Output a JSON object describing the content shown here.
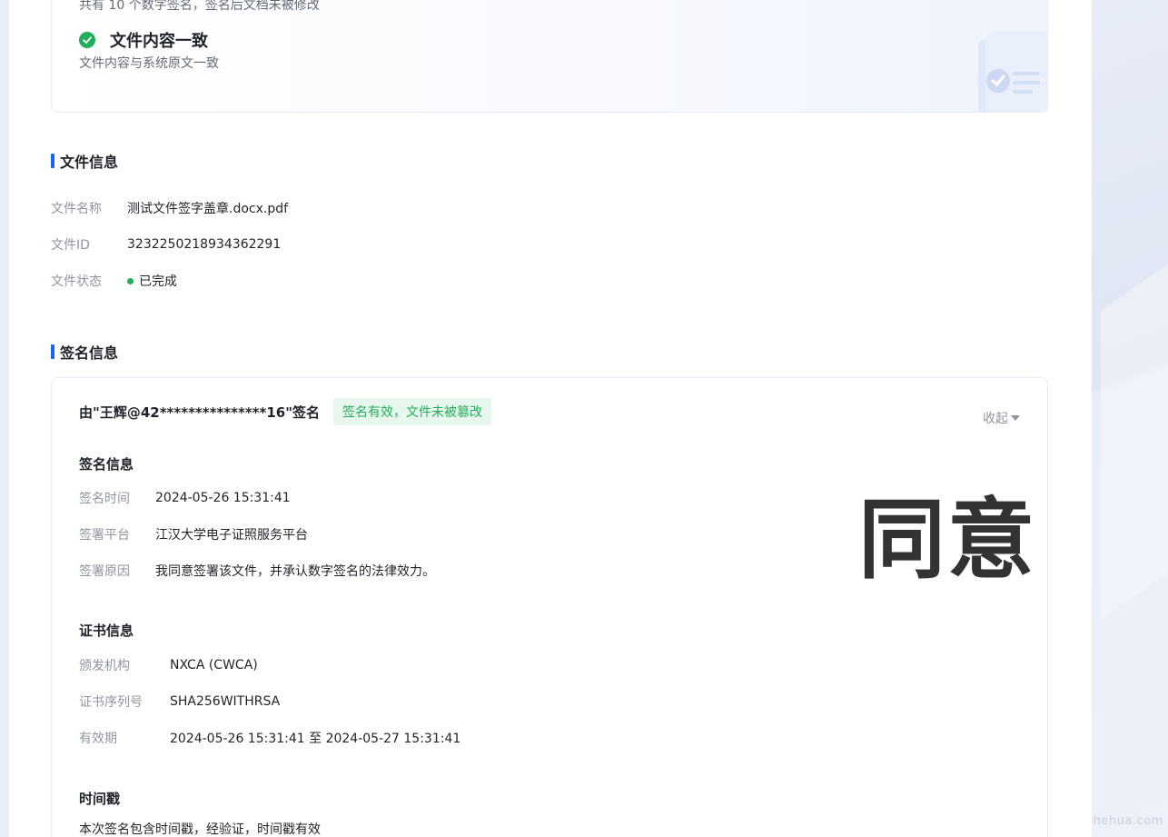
{
  "summary": {
    "subtitle": "共有 10 个数字签名，签名后文档未被修改",
    "title": "文件内容一致",
    "description": "文件内容与系统原文一致"
  },
  "file_info": {
    "title": "文件信息",
    "name_label": "文件名称",
    "name_value": "测试文件签字盖章.docx.pdf",
    "id_label": "文件ID",
    "id_value": "3232250218934362291",
    "status_label": "文件状态",
    "status_value": "已完成",
    "status_color": "#21ad5a"
  },
  "signature_info": {
    "title": "签名信息",
    "card": {
      "signer": "由\"王辉@42***************16\"签名",
      "badge": "签名有效，文件未被篡改",
      "collapse_label": "收起",
      "seal_text": "同意",
      "sig": {
        "title": "签名信息",
        "time_label": "签名时间",
        "time_value": "2024-05-26 15:31:41",
        "platform_label": "签署平台",
        "platform_value": "江汉大学电子证照服务平台",
        "reason_label": "签署原因",
        "reason_value": "我同意签署该文件，并承认数字签名的法律效力。"
      },
      "cert": {
        "title": "证书信息",
        "issuer_label": "颁发机构",
        "issuer_value": "NXCA (CWCA)",
        "serial_label": "证书序列号",
        "serial_value": "SHA256WITHRSA",
        "validity_label": "有效期",
        "validity_value": "2024-05-26 15:31:41 至 2024-05-27 15:31:41"
      },
      "timestamp": {
        "title": "时间戳",
        "description": "本次签名包含时间戳，经验证，时间戳有效"
      }
    }
  },
  "watermark": "chehua.com",
  "colors": {
    "accent": "#1664ff",
    "success": "#21ad5a",
    "success_bg": "#e8f7ee"
  }
}
